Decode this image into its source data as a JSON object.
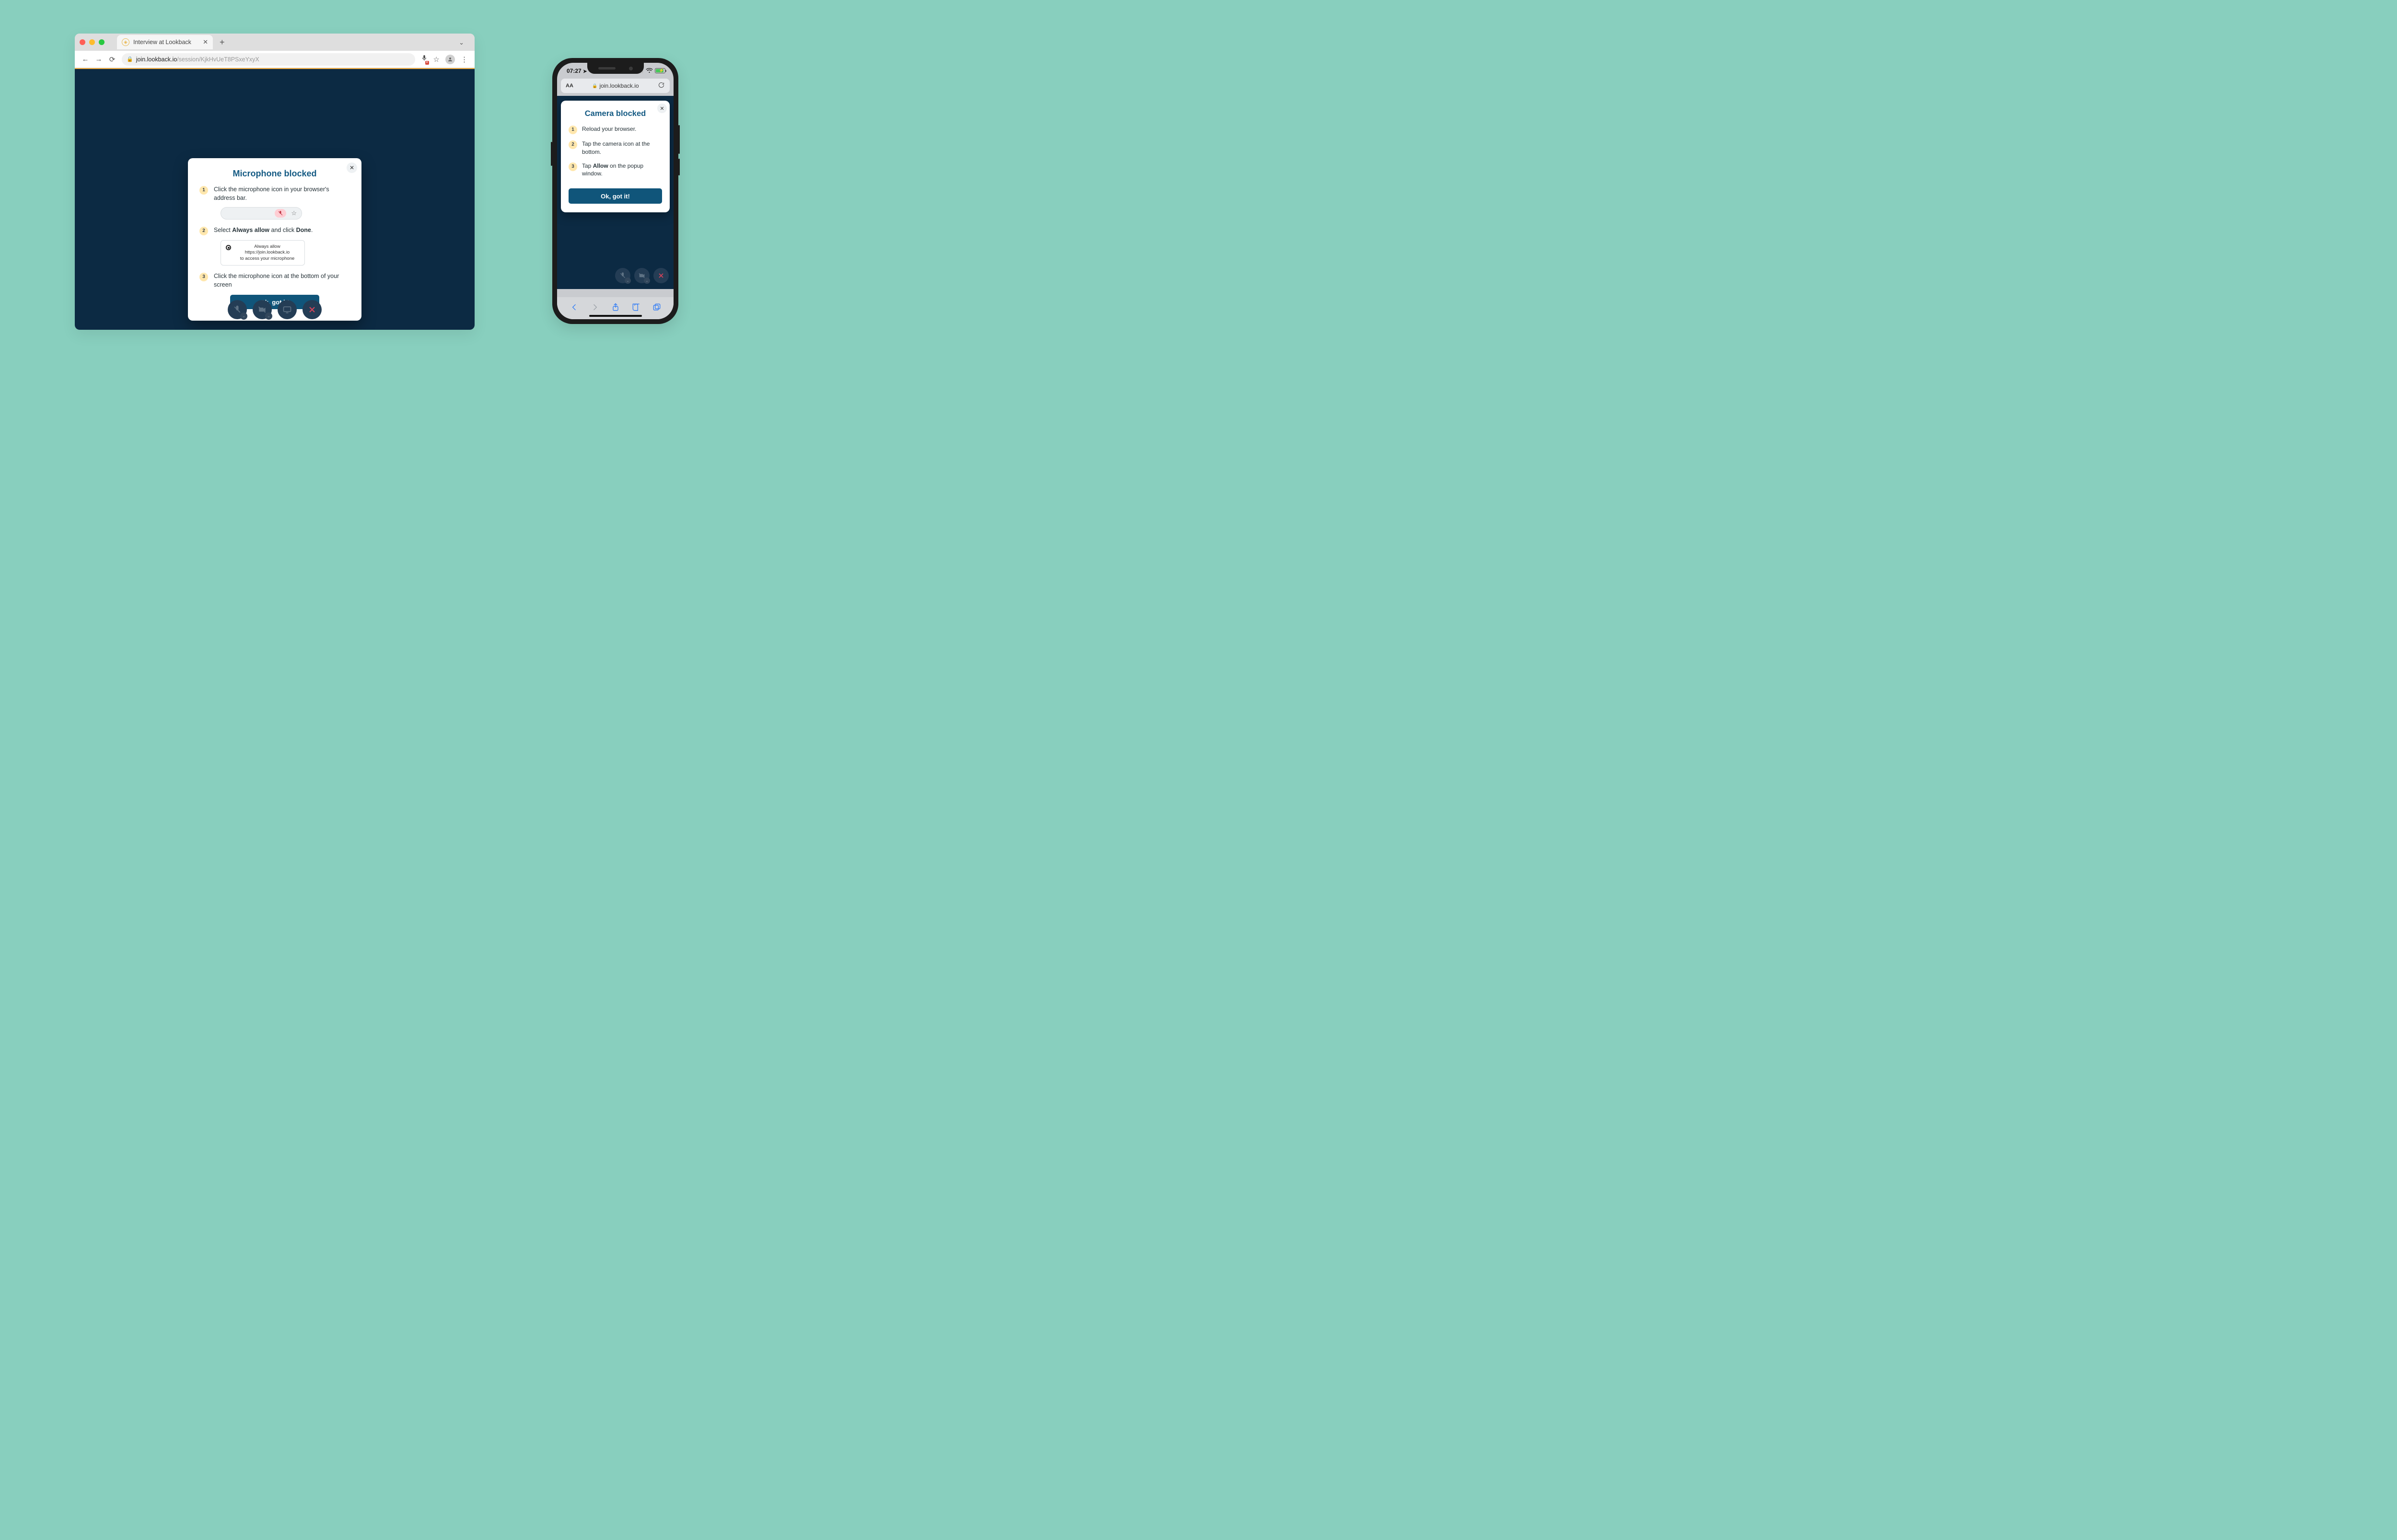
{
  "browser": {
    "tab_title": "Interview at Lookback",
    "url_host": "join.lookback.io",
    "url_path": "/session/KjkHvUeT8PSxeYxyX"
  },
  "desktop_modal": {
    "title": "Microphone blocked",
    "step1": "Click the microphone icon in your browser's address bar.",
    "step2_pre": "Select ",
    "step2_bold1": "Always allow",
    "step2_mid": " and click ",
    "step2_bold2": "Done",
    "step2_post": ".",
    "radio_line1": "Always allow https://join.lookback.io",
    "radio_line2": "to access your microphone",
    "step3": "Click the microphone icon at the bottom of your screen",
    "ok": "Ok, got it!"
  },
  "phone": {
    "time": "07:27",
    "url": "join.lookback.io"
  },
  "mobile_modal": {
    "title": "Camera blocked",
    "step1": "Reload your browser.",
    "step2": "Tap the camera icon at the bottom.",
    "step3_pre": "Tap ",
    "step3_bold": "Allow",
    "step3_post": " on the popup window.",
    "ok": "Ok, got it!"
  }
}
